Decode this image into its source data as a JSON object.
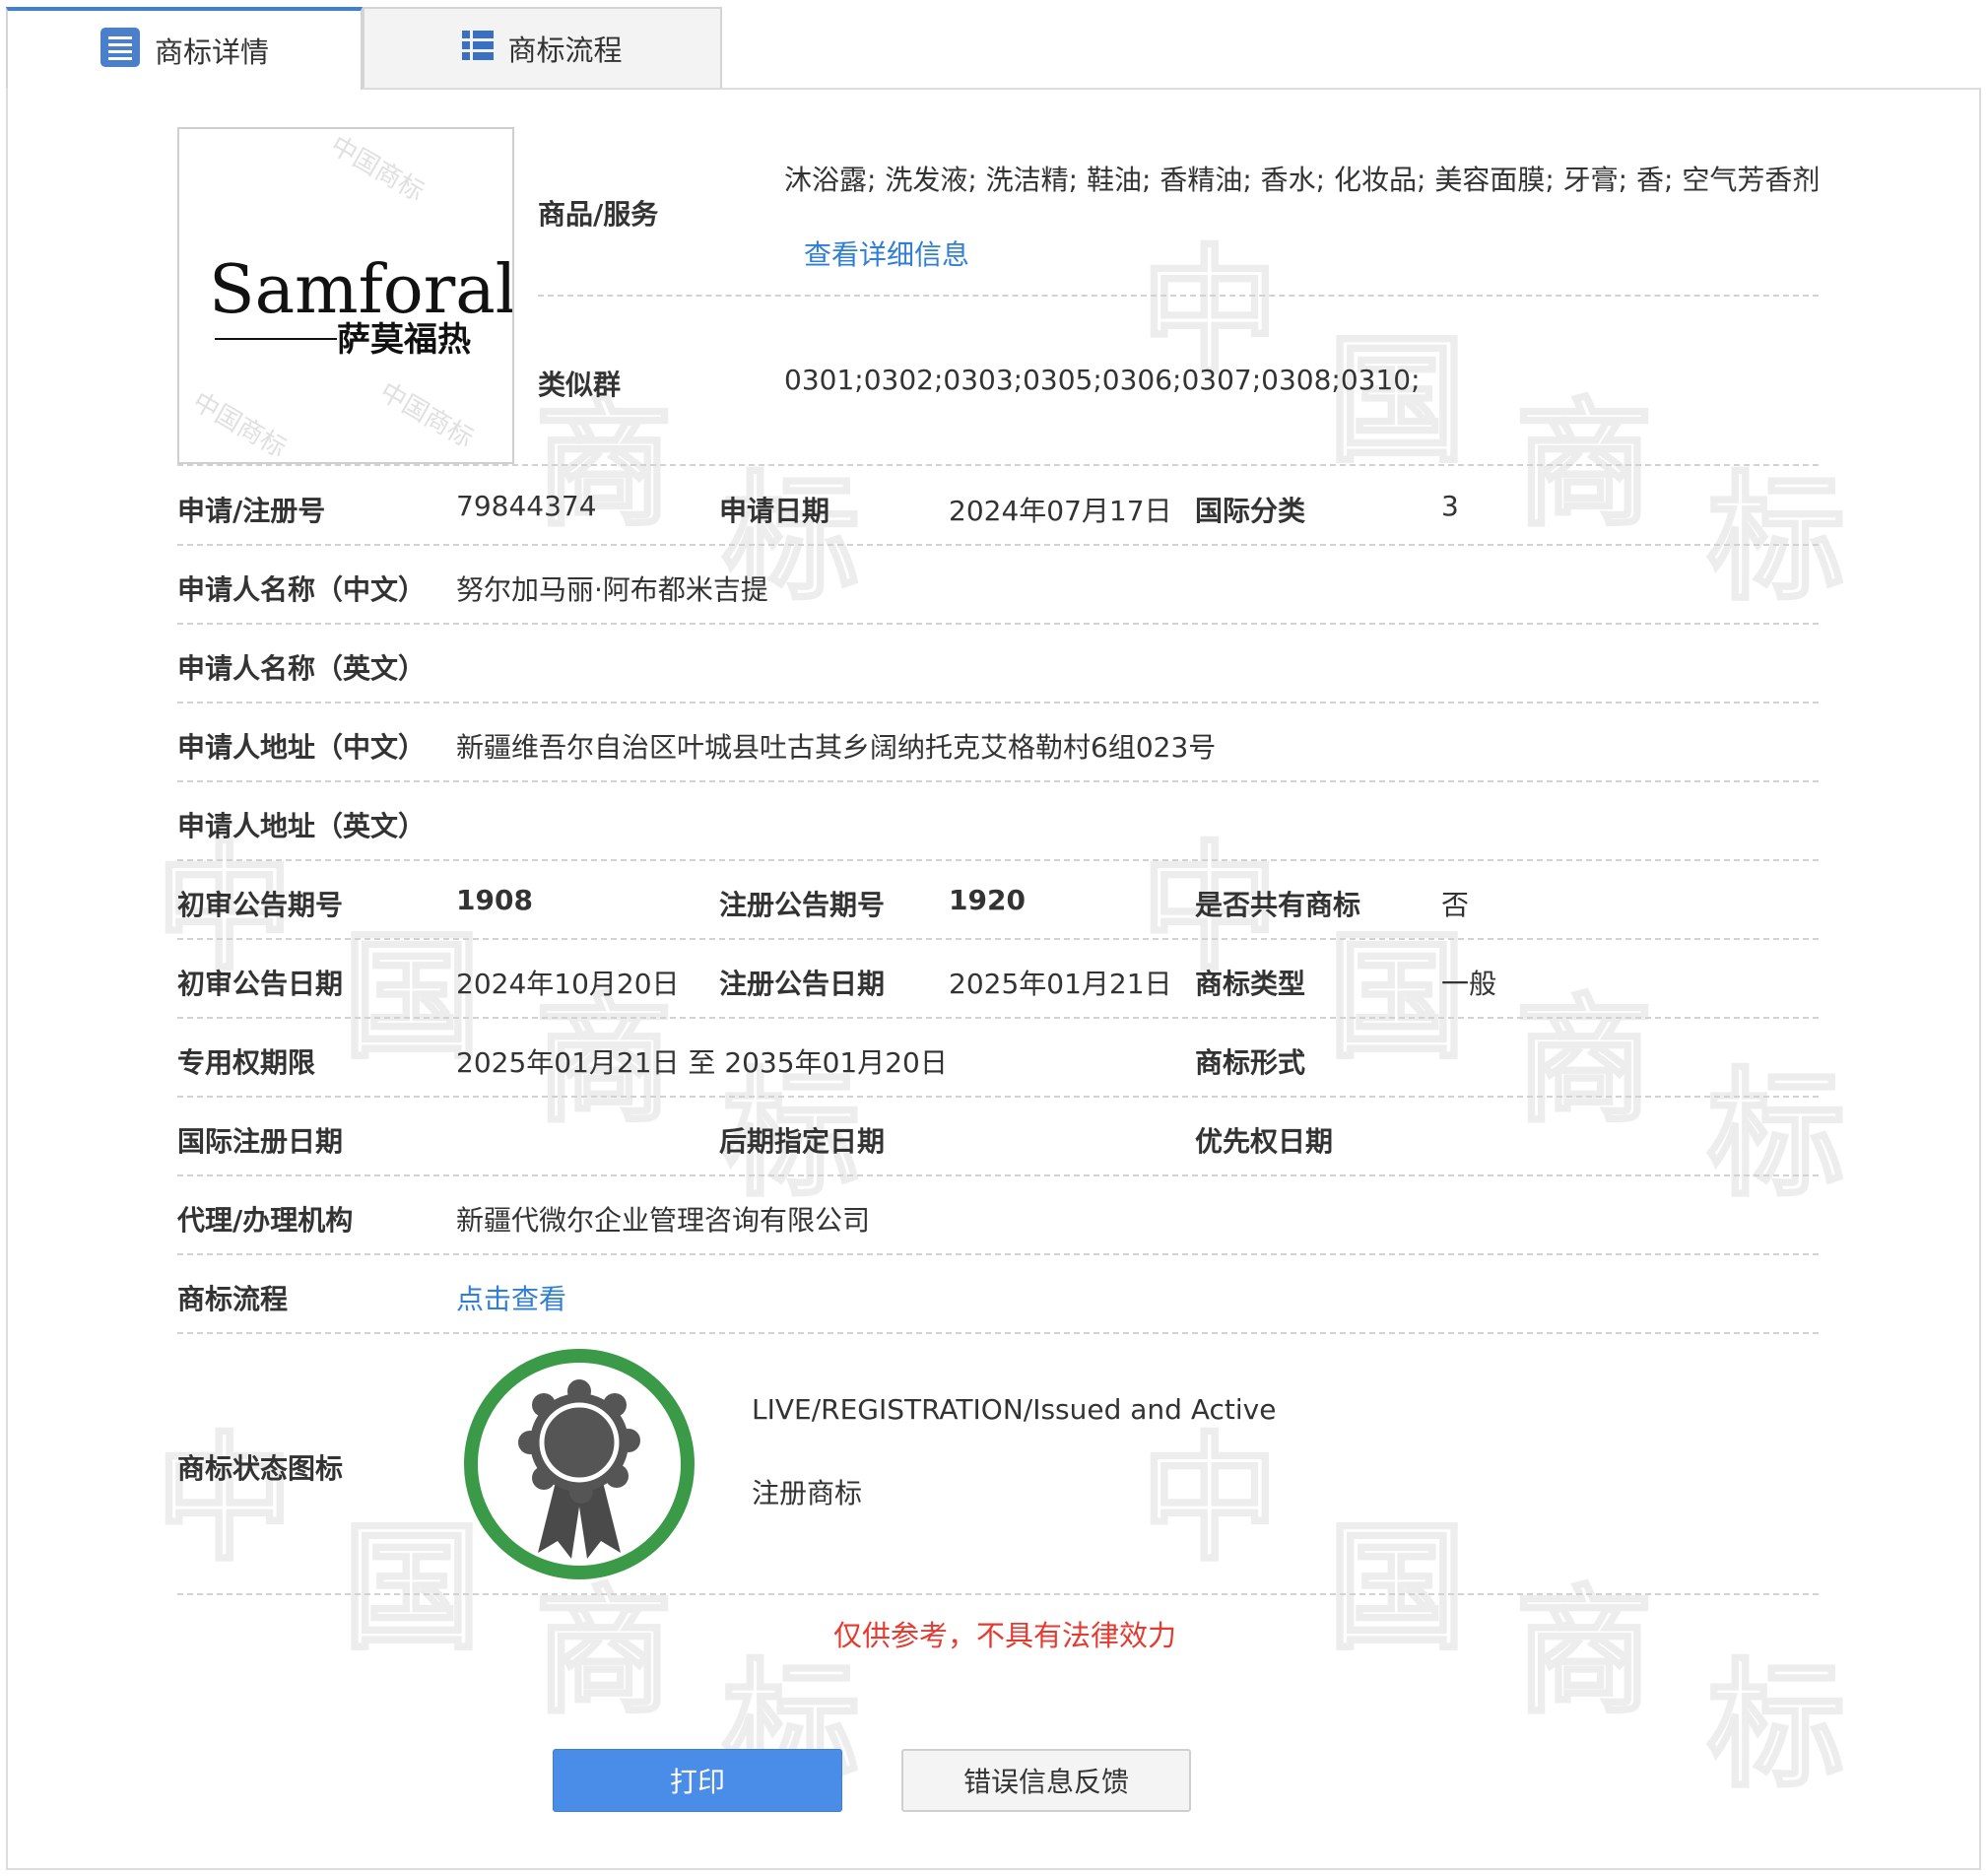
{
  "tabs": [
    {
      "label": "商标详情",
      "icon": "list-doc-icon",
      "active": true
    },
    {
      "label": "商标流程",
      "icon": "list-grid-icon",
      "active": false
    }
  ],
  "logo": {
    "word": "Samforal",
    "chinese": "萨莫福热",
    "watermark": "中国商标"
  },
  "goods": {
    "label": "商品/服务",
    "value": "沐浴露; 洗发液; 洗洁精; 鞋油; 香精油; 香水; 化妆品; 美容面膜; 牙膏; 香; 空气芳香剂",
    "detail_link": "查看详细信息"
  },
  "similar_group": {
    "label": "类似群",
    "value": "0301;0302;0303;0305;0306;0307;0308;0310;"
  },
  "details": {
    "reg_no_label": "申请/注册号",
    "reg_no": "79844374",
    "apply_date_label": "申请日期",
    "apply_date": "2024年07月17日",
    "intl_class_label": "国际分类",
    "intl_class": "3",
    "applicant_cn_label": "申请人名称（中文）",
    "applicant_cn": "努尔加马丽·阿布都米吉提",
    "applicant_en_label": "申请人名称（英文）",
    "applicant_en": "",
    "address_cn_label": "申请人地址（中文）",
    "address_cn": "新疆维吾尔自治区叶城县吐古其乡阔纳托克艾格勒村6组023号",
    "address_en_label": "申请人地址（英文）",
    "address_en": "",
    "prelim_issue_label": "初审公告期号",
    "prelim_issue": "1908",
    "reg_issue_label": "注册公告期号",
    "reg_issue": "1920",
    "shared_label": "是否共有商标",
    "shared": "否",
    "prelim_date_label": "初审公告日期",
    "prelim_date": "2024年10月20日",
    "reg_date_label": "注册公告日期",
    "reg_date": "2025年01月21日",
    "tm_type_label": "商标类型",
    "tm_type": "一般",
    "exclusive_label": "专用权期限",
    "exclusive": "2025年01月21日 至 2035年01月20日",
    "tm_form_label": "商标形式",
    "tm_form": "",
    "intl_reg_date_label": "国际注册日期",
    "intl_reg_date": "",
    "later_date_label": "后期指定日期",
    "later_date": "",
    "priority_date_label": "优先权日期",
    "priority_date": "",
    "agency_label": "代理/办理机构",
    "agency": "新疆代微尔企业管理咨询有限公司",
    "process_label": "商标流程",
    "process_link": "点击查看",
    "status_label": "商标状态图标",
    "status_en": "LIVE/REGISTRATION/Issued and Active",
    "status_cn": "注册商标"
  },
  "disclaimer": "仅供参考，不具有法律效力",
  "buttons": {
    "print": "打印",
    "feedback": "错误信息反馈"
  },
  "watermark": {
    "chars": [
      "中",
      "国",
      "商",
      "标"
    ]
  },
  "colors": {
    "accent": "#4a8de8",
    "link": "#2f7fd6",
    "warning": "#e53a2f",
    "badge_ring": "#3a9a47",
    "badge_seal": "#555555"
  }
}
